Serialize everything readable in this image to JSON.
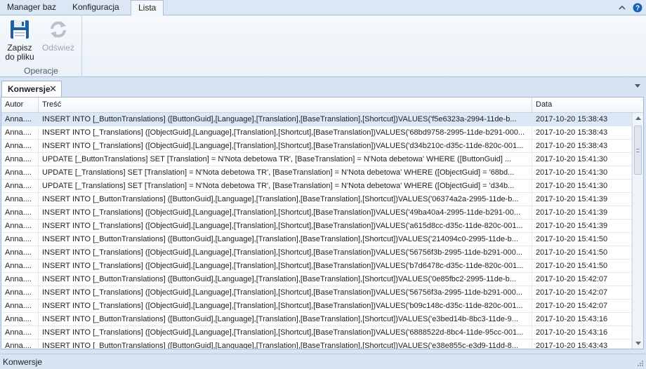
{
  "menu": {
    "tabs": [
      {
        "label": "Manager baz"
      },
      {
        "label": "Konfiguracja"
      },
      {
        "label": "Lista"
      }
    ]
  },
  "ribbon": {
    "save_label": "Zapisz\ndo pliku",
    "refresh_label": "Odśwież",
    "group_label": "Operacje"
  },
  "doc_tab": {
    "label": "Konwersje"
  },
  "grid": {
    "columns": [
      "Autor",
      "Treść",
      "Data"
    ],
    "rows": [
      {
        "autor": "Anna....",
        "tresc": "INSERT INTO [_ButtonTranslations] ([ButtonGuid],[Language],[Translation],[BaseTranslation],[Shortcut])VALUES('f5e6323a-2994-11de-b...",
        "data": "2017-10-20 15:38:43"
      },
      {
        "autor": "Anna....",
        "tresc": "INSERT INTO [_Translations] ([ObjectGuid],[Language],[Translation],[Shortcut],[BaseTranslation])VALUES('68bd9758-2995-11de-b291-000...",
        "data": "2017-10-20 15:38:43"
      },
      {
        "autor": "Anna....",
        "tresc": "INSERT INTO [_Translations] ([ObjectGuid],[Language],[Translation],[Shortcut],[BaseTranslation])VALUES('d34b210c-d35c-11de-820c-001...",
        "data": "2017-10-20 15:38:43"
      },
      {
        "autor": "Anna....",
        "tresc": "UPDATE [_ButtonTranslations] SET [Translation] = N'Nota debetowa TR', [BaseTranslation] = N'Nota debetowa' WHERE ([ButtonGuid] ...",
        "data": "2017-10-20 15:41:30"
      },
      {
        "autor": "Anna....",
        "tresc": "UPDATE [_Translations] SET [Translation] = N'Nota debetowa TR', [BaseTranslation] = N'Nota debetowa' WHERE ([ObjectGuid] = '68bd...",
        "data": "2017-10-20 15:41:30"
      },
      {
        "autor": "Anna....",
        "tresc": "UPDATE [_Translations] SET [Translation] = N'Nota debetowa TR', [BaseTranslation] = N'Nota debetowa' WHERE ([ObjectGuid] = 'd34b...",
        "data": "2017-10-20 15:41:30"
      },
      {
        "autor": "Anna....",
        "tresc": "INSERT INTO [_ButtonTranslations] ([ButtonGuid],[Language],[Translation],[BaseTranslation],[Shortcut])VALUES('06374a2a-2995-11de-b...",
        "data": "2017-10-20 15:41:39"
      },
      {
        "autor": "Anna....",
        "tresc": "INSERT INTO [_Translations] ([ObjectGuid],[Language],[Translation],[Shortcut],[BaseTranslation])VALUES('49ba40a4-2995-11de-b291-00...",
        "data": "2017-10-20 15:41:39"
      },
      {
        "autor": "Anna....",
        "tresc": "INSERT INTO [_Translations] ([ObjectGuid],[Language],[Translation],[Shortcut],[BaseTranslation])VALUES('a615d8cc-d35c-11de-820c-001...",
        "data": "2017-10-20 15:41:39"
      },
      {
        "autor": "Anna....",
        "tresc": "INSERT INTO [_ButtonTranslations] ([ButtonGuid],[Language],[Translation],[BaseTranslation],[Shortcut])VALUES('214094c0-2995-11de-b...",
        "data": "2017-10-20 15:41:50"
      },
      {
        "autor": "Anna....",
        "tresc": "INSERT INTO [_Translations] ([ObjectGuid],[Language],[Translation],[Shortcut],[BaseTranslation])VALUES('56756f3b-2995-11de-b291-000...",
        "data": "2017-10-20 15:41:50"
      },
      {
        "autor": "Anna....",
        "tresc": "INSERT INTO [_Translations] ([ObjectGuid],[Language],[Translation],[Shortcut],[BaseTranslation])VALUES('b7d6478c-d35c-11de-820c-001...",
        "data": "2017-10-20 15:41:50"
      },
      {
        "autor": "Anna....",
        "tresc": "INSERT INTO [_ButtonTranslations] ([ButtonGuid],[Language],[Translation],[BaseTranslation],[Shortcut])VALUES('0e85fbc2-2995-11de-b...",
        "data": "2017-10-20 15:42:07"
      },
      {
        "autor": "Anna....",
        "tresc": "INSERT INTO [_Translations] ([ObjectGuid],[Language],[Translation],[Shortcut],[BaseTranslation])VALUES('56756f3a-2995-11de-b291-000...",
        "data": "2017-10-20 15:42:07"
      },
      {
        "autor": "Anna....",
        "tresc": "INSERT INTO [_Translations] ([ObjectGuid],[Language],[Translation],[Shortcut],[BaseTranslation])VALUES('b09c148c-d35c-11de-820c-001...",
        "data": "2017-10-20 15:42:07"
      },
      {
        "autor": "Anna....",
        "tresc": "INSERT INTO [_ButtonTranslations] ([ButtonGuid],[Language],[Translation],[BaseTranslation],[Shortcut])VALUES('e3bed14b-8bc3-11de-9...",
        "data": "2017-10-20 15:43:16"
      },
      {
        "autor": "Anna....",
        "tresc": "INSERT INTO [_Translations] ([ObjectGuid],[Language],[Translation],[Shortcut],[BaseTranslation])VALUES('6888522d-8bc4-11de-95cc-001...",
        "data": "2017-10-20 15:43:16"
      },
      {
        "autor": "Anna....",
        "tresc": "INSERT INTO [_ButtonTranslations] ([ButtonGuid],[Language],[Translation],[BaseTranslation],[Shortcut])VALUES('e38e855c-e3d9-11dd-8...",
        "data": "2017-10-20 15:43:43"
      }
    ]
  },
  "status": {
    "text": "Konwersje"
  },
  "colors": {
    "accent": "#1a5fb4",
    "selected_row": "#dce8f6",
    "chrome": "#d6e4f3"
  },
  "icons": [
    "floppy-disk-icon",
    "refresh-icon",
    "collapse-ribbon-icon",
    "help-icon",
    "close-icon",
    "chevron-down-icon"
  ]
}
